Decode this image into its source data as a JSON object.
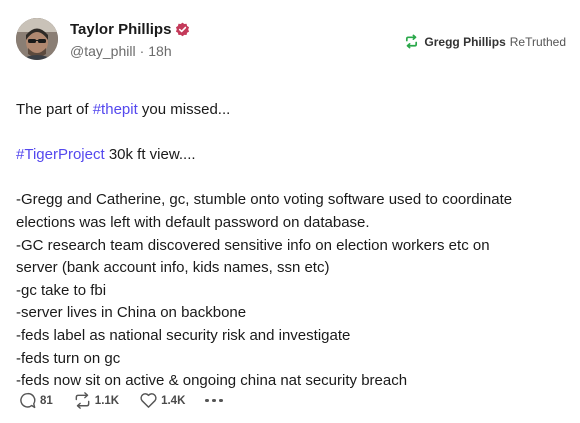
{
  "author": {
    "display_name": "Taylor Phillips",
    "handle": "@tay_phill",
    "separator": "·",
    "time": "18h"
  },
  "retruth": {
    "user": "Gregg Phillips",
    "label": "ReTruthed"
  },
  "post": {
    "lines": [
      {
        "parts": [
          {
            "text": "The part of "
          },
          {
            "text": "#thepit",
            "tag": true
          },
          {
            "text": " you missed..."
          }
        ]
      },
      {
        "parts": [
          {
            "text": ""
          }
        ]
      },
      {
        "parts": [
          {
            "text": "#TigerProject",
            "tag": true
          },
          {
            "text": " 30k ft view...."
          }
        ]
      },
      {
        "parts": [
          {
            "text": ""
          }
        ]
      },
      {
        "parts": [
          {
            "text": "-Gregg and Catherine, gc, stumble onto voting software used to coordinate"
          }
        ]
      },
      {
        "parts": [
          {
            "text": "elections was left with default password on database."
          }
        ]
      },
      {
        "parts": [
          {
            "text": "-GC research team discovered sensitive info on election workers etc on"
          }
        ]
      },
      {
        "parts": [
          {
            "text": "server (bank account info, kids names, ssn etc)"
          }
        ]
      },
      {
        "parts": [
          {
            "text": "-gc take to fbi"
          }
        ]
      },
      {
        "parts": [
          {
            "text": "-server lives in China on backbone"
          }
        ]
      },
      {
        "parts": [
          {
            "text": "-feds label as national security risk and investigate"
          }
        ]
      },
      {
        "parts": [
          {
            "text": "-feds turn on gc"
          }
        ]
      },
      {
        "parts": [
          {
            "text": "-feds now sit on active & ongoing china nat security breach"
          }
        ]
      }
    ]
  },
  "actions": {
    "replies": "81",
    "retruths": "1.1K",
    "likes": "1.4K"
  },
  "colors": {
    "hashtag": "#5448ee",
    "verified": "#c43a5a",
    "retruth_icon": "#2aa84a"
  },
  "icons": {
    "verified": "verified-badge-icon",
    "retruth": "retruth-icon",
    "reply": "reply-icon",
    "like": "heart-icon",
    "more": "more-dots-icon"
  }
}
